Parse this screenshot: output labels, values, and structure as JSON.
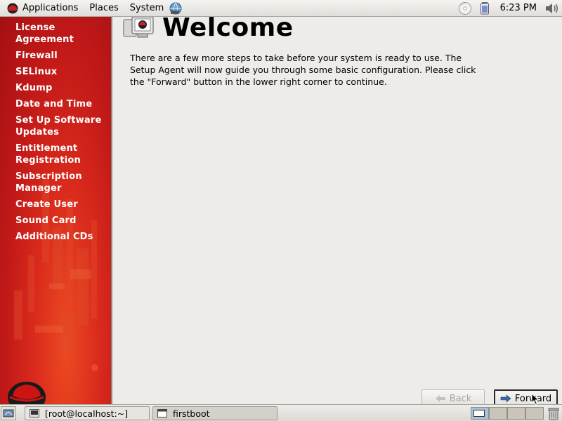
{
  "top_panel": {
    "menus": [
      "Applications",
      "Places",
      "System"
    ],
    "clock": "6:23 PM",
    "tray_icons": [
      "cd-icon",
      "battery-icon",
      "volume-icon"
    ]
  },
  "sidebar": {
    "steps": [
      "License Agreement",
      "Firewall",
      "SELinux",
      "Kdump",
      "Date and Time",
      "Set Up Software Updates",
      "Entitlement Registration",
      "Subscription Manager",
      "Create User",
      "Sound Card",
      "Additional CDs"
    ]
  },
  "main": {
    "title": "Welcome",
    "body": "There are a few more steps to take before your system is ready to use.  The Setup Agent will now guide you through some basic configuration.  Please click the \"Forward\" button in the lower right corner to continue.",
    "back_label": "Back",
    "forward_label": "Forward"
  },
  "bottom_panel": {
    "tasks": [
      "[root@localhost:~]",
      "firstboot"
    ],
    "active_workspace": 1,
    "workspace_count": 4
  },
  "colors": {
    "sidebar_red": "#c11918",
    "panel_bg": "#e6e4df",
    "content_bg": "#edeceb"
  }
}
